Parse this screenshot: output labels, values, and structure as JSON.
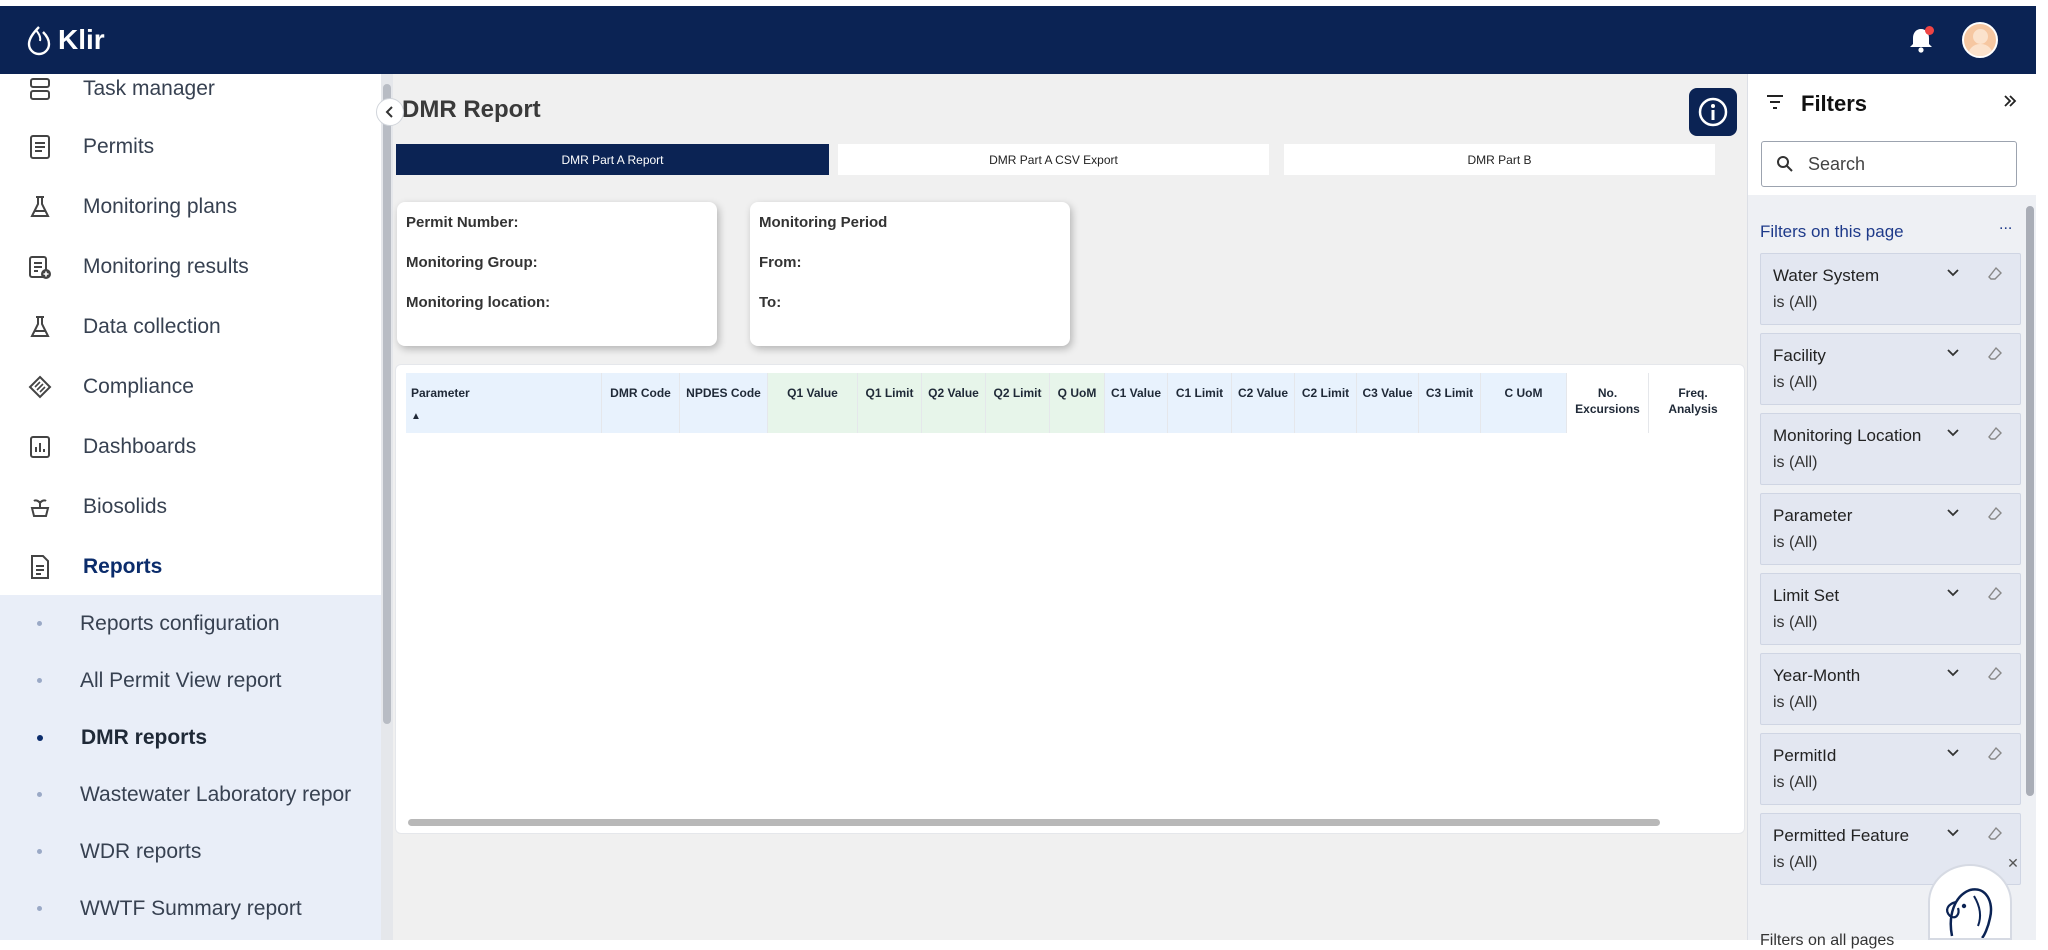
{
  "app": {
    "name": "Klir"
  },
  "nav": [
    {
      "label": "Task manager",
      "icon": "task-manager-icon"
    },
    {
      "label": "Permits",
      "icon": "document-icon"
    },
    {
      "label": "Monitoring plans",
      "icon": "flask-icon"
    },
    {
      "label": "Monitoring results",
      "icon": "clipboard-plus-icon"
    },
    {
      "label": "Data collection",
      "icon": "flask-icon"
    },
    {
      "label": "Compliance",
      "icon": "hatched-shape-icon"
    },
    {
      "label": "Dashboards",
      "icon": "bar-chart-icon"
    },
    {
      "label": "Biosolids",
      "icon": "plant-bowl-icon"
    },
    {
      "label": "Reports",
      "icon": "document-icon"
    }
  ],
  "subnav": [
    {
      "label": "Reports configuration"
    },
    {
      "label": "All Permit View report"
    },
    {
      "label": "DMR reports"
    },
    {
      "label": "Wastewater Laboratory repor"
    },
    {
      "label": "WDR reports"
    },
    {
      "label": "WWTF Summary report"
    }
  ],
  "report": {
    "title": "DMR Report",
    "tabs": [
      "DMR Part A Report",
      "DMR Part A CSV Export",
      "DMR Part B"
    ],
    "permit_card": [
      "Permit Number:",
      "Monitoring Group:",
      "Monitoring location:"
    ],
    "period_card": [
      "Monitoring Period",
      "From:",
      "To:"
    ],
    "columns": [
      "Parameter",
      "DMR Code",
      "NPDES Code",
      "Q1 Value",
      "Q1 Limit",
      "Q2 Value",
      "Q2 Limit",
      "Q UoM",
      "C1 Value",
      "C1 Limit",
      "C2 Value",
      "C2 Limit",
      "C3 Value",
      "C3 Limit",
      "C UoM",
      "No. Excursions",
      "Freq. Analysis"
    ],
    "sort_indicator": "▲"
  },
  "filters": {
    "title": "Filters",
    "search_placeholder": "Search",
    "section": "Filters on this page",
    "more": "...",
    "items": [
      {
        "name": "Water System",
        "value": "is (All)"
      },
      {
        "name": "Facility",
        "value": "is (All)"
      },
      {
        "name": "Monitoring Location",
        "value": "is (All)"
      },
      {
        "name": "Parameter",
        "value": "is (All)"
      },
      {
        "name": "Limit Set",
        "value": "is (All)"
      },
      {
        "name": "Year-Month",
        "value": "is (All)"
      },
      {
        "name": "PermitId",
        "value": "is (All)"
      },
      {
        "name": "Permitted Feature",
        "value": "is (All)"
      }
    ],
    "next_section": "Filters on all pages"
  },
  "colors": {
    "navy": "#0b2354",
    "blue_header": "#e8f2fd",
    "green_header": "#e7f5ea"
  }
}
